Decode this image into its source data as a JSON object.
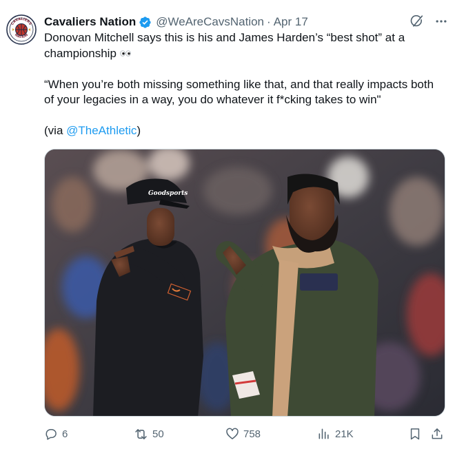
{
  "author": {
    "display_name": "Cavaliers Nation",
    "handle": "@WeAreCavsNation",
    "separator": "·",
    "date": "Apr 17",
    "avatar_text_top": "CAVALIERS",
    "avatar_text_bottom": "NATION"
  },
  "tweet": {
    "line1": "Donovan Mitchell says this is his and James Harden’s “best shot” at a championship",
    "line2": "“When you’re both missing something like that, and that really impacts both of your legacies in a way, you do whatever it f*cking takes to win\"",
    "via_prefix": "(via ",
    "via_mention": "@TheAthletic",
    "via_suffix": ")"
  },
  "media": {
    "cap_text": "Goodsports"
  },
  "actions": {
    "replies": "6",
    "reposts": "50",
    "likes": "758",
    "views": "21K"
  },
  "colors": {
    "accent": "#1d9bf0",
    "secondary_text": "#536471",
    "primary_text": "#0f1419"
  },
  "icons": [
    "verified-icon",
    "grok-icon",
    "more-icon",
    "reply-icon",
    "repost-icon",
    "like-icon",
    "views-icon",
    "bookmark-icon",
    "share-icon"
  ]
}
